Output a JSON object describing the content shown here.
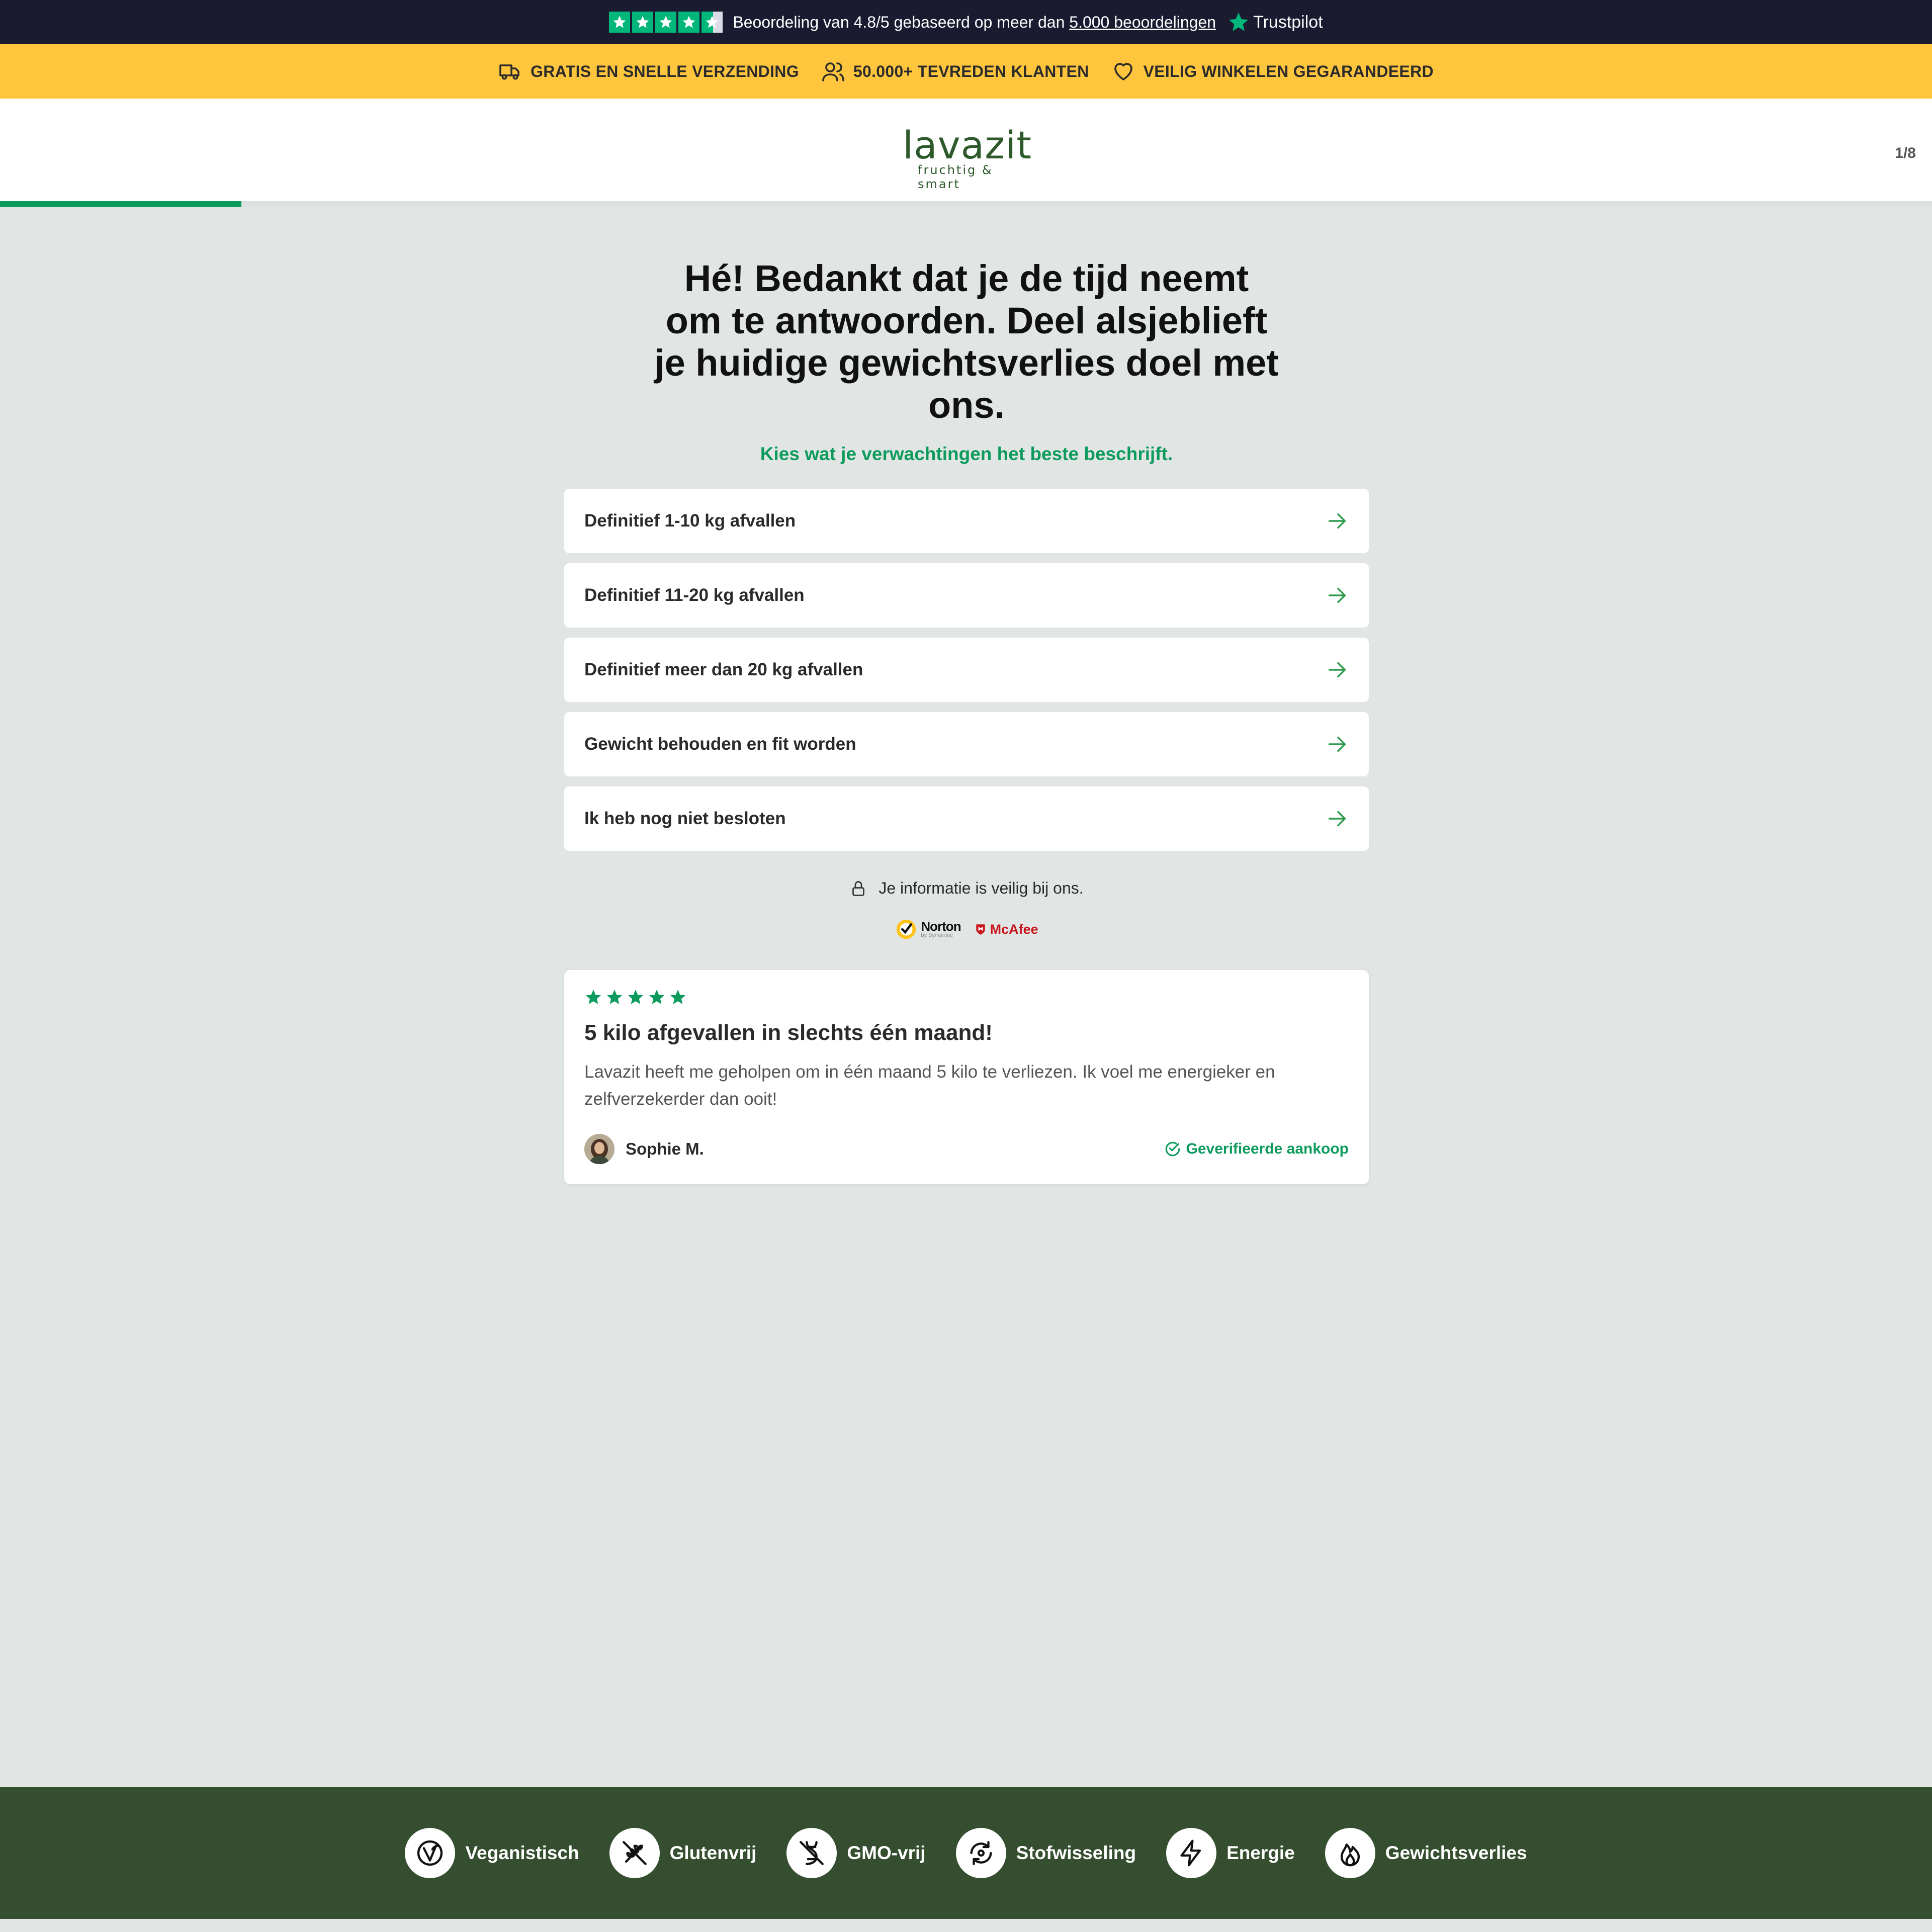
{
  "trustpilot": {
    "rating_text": "Beoordeling van 4.8/5 gebaseerd op meer dan",
    "reviews_link": "5.000 beoordelingen",
    "brand": "Trustpilot",
    "rating": 4.8,
    "stars_max": 5,
    "star_color": "#00b67a"
  },
  "usp_bar": {
    "items": [
      {
        "icon": "truck-icon",
        "label": "GRATIS EN SNELLE VERZENDING"
      },
      {
        "icon": "users-icon",
        "label": "50.000+ TEVREDEN KLANTEN"
      },
      {
        "icon": "heart-icon",
        "label": "VEILIG WINKELEN GEGARANDEERD"
      }
    ],
    "background": "#ffc53d"
  },
  "header": {
    "logo_word": "lavazit",
    "logo_tagline": "fruchtig & smart",
    "step": "1/8",
    "progress_fraction": 0.125
  },
  "quiz": {
    "headline": "Hé! Bedankt dat je de tijd neemt om te antwoorden. Deel alsjeblieft je huidige gewichtsverlies doel met ons.",
    "subheadline": "Kies wat je verwachtingen het beste beschrijft.",
    "options": [
      {
        "label": "Definitief 1-10 kg afvallen"
      },
      {
        "label": "Definitief 11-20 kg afvallen"
      },
      {
        "label": "Definitief meer dan 20 kg afvallen"
      },
      {
        "label": "Gewicht behouden en fit worden"
      },
      {
        "label": "Ik heb nog niet besloten"
      }
    ],
    "accent": "#0c9b5c"
  },
  "security": {
    "text": "Je informatie is veilig bij ons.",
    "norton": "Norton",
    "norton_sub": "by Symantec",
    "mcafee": "McAfee"
  },
  "review": {
    "stars": 5,
    "title": "5 kilo afgevallen in slechts één maand!",
    "body": "Lavazit heeft me geholpen om in één maand 5 kilo te verliezen. Ik voel me energieker en zelfverzekerder dan ooit!",
    "author": "Sophie M.",
    "verified": "Geverifieerde aankoop"
  },
  "footer": {
    "background": "#344e2f",
    "features": [
      {
        "icon": "vegan-icon",
        "label": "Veganistisch"
      },
      {
        "icon": "gluten-free-icon",
        "label": "Glutenvrij"
      },
      {
        "icon": "gmo-free-icon",
        "label": "GMO-vrij"
      },
      {
        "icon": "metabolism-icon",
        "label": "Stofwisseling"
      },
      {
        "icon": "energy-icon",
        "label": "Energie"
      },
      {
        "icon": "flame-icon",
        "label": "Gewichtsverlies"
      }
    ]
  }
}
